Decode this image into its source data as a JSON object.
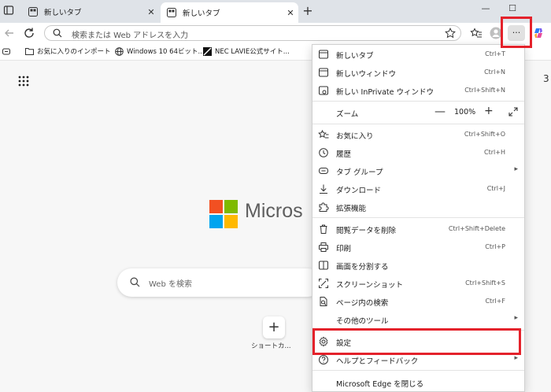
{
  "tabs": [
    {
      "label": "新しいタブ",
      "close": "✕"
    },
    {
      "label": "新しいタブ",
      "close": "✕"
    }
  ],
  "newtab": "+",
  "window_controls": {
    "minimize": "—",
    "maximize": "☐"
  },
  "address": {
    "placeholder": "検索または Web アドレスを入力"
  },
  "more_button": "···",
  "bookmarks": [
    {
      "label": "お気に入りのインポート"
    },
    {
      "label": "Windows 10 64ビット..."
    },
    {
      "label": "NEC LAVIE公式サイト..."
    }
  ],
  "ntp": {
    "brand": "Micros",
    "search_placeholder": "Web を検索",
    "shortcut_plus": "+",
    "shortcut_label": "ショートカ...",
    "right_digit": "3"
  },
  "menu": {
    "new_tab": {
      "label": "新しいタブ",
      "shortcut": "Ctrl+T"
    },
    "new_window": {
      "label": "新しいウィンドウ",
      "shortcut": "Ctrl+N"
    },
    "inprivate": {
      "label": "新しい InPrivate ウィンドウ",
      "shortcut": "Ctrl+Shift+N"
    },
    "zoom": {
      "label": "ズーム",
      "minus": "—",
      "value": "100%",
      "plus": "+"
    },
    "favorites": {
      "label": "お気に入り",
      "shortcut": "Ctrl+Shift+O"
    },
    "history": {
      "label": "履歴",
      "shortcut": "Ctrl+H"
    },
    "tab_groups": {
      "label": "タブ グループ",
      "arrow": "▸"
    },
    "downloads": {
      "label": "ダウンロード",
      "shortcut": "Ctrl+J"
    },
    "extensions": {
      "label": "拡張機能"
    },
    "clear_data": {
      "label": "閲覧データを削除",
      "shortcut": "Ctrl+Shift+Delete"
    },
    "print": {
      "label": "印刷",
      "shortcut": "Ctrl+P"
    },
    "split": {
      "label": "画面を分割する"
    },
    "screenshot": {
      "label": "スクリーンショット",
      "shortcut": "Ctrl+Shift+S"
    },
    "find": {
      "label": "ページ内の検索",
      "shortcut": "Ctrl+F"
    },
    "more_tools": {
      "label": "その他のツール",
      "arrow": "▸"
    },
    "settings": {
      "label": "設定"
    },
    "help": {
      "label": "ヘルプとフィードバック",
      "arrow": "▸"
    },
    "close": {
      "label": "Microsoft Edge を閉じる"
    }
  },
  "colors": {
    "highlight": "#e4222b",
    "ms_red": "#f25022",
    "ms_green": "#7fba00",
    "ms_blue": "#00a4ef",
    "ms_yellow": "#ffb900"
  }
}
